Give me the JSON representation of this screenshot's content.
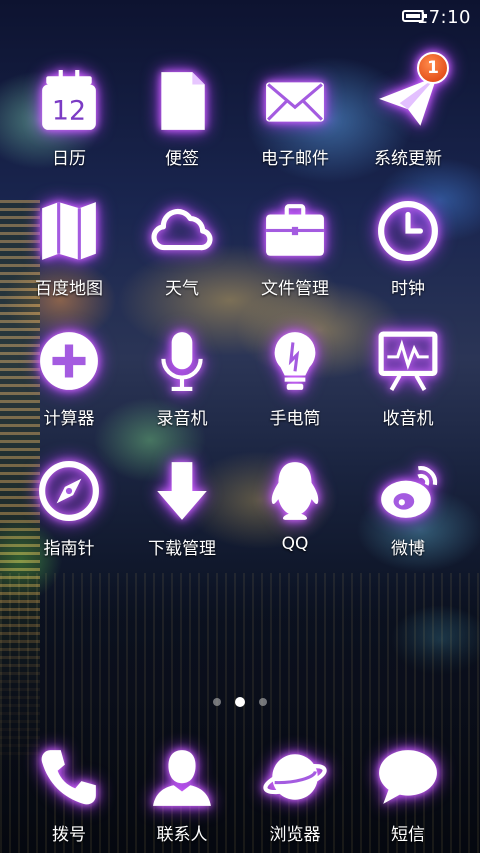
{
  "status_bar": {
    "time": "17:10",
    "battery_icon": "battery-full-icon"
  },
  "apps": [
    {
      "label": "日历",
      "icon": "calendar-icon",
      "day": "12"
    },
    {
      "label": "便签",
      "icon": "note-icon"
    },
    {
      "label": "电子邮件",
      "icon": "mail-icon"
    },
    {
      "label": "系统更新",
      "icon": "paper-plane-icon",
      "badge": "1"
    },
    {
      "label": "百度地图",
      "icon": "map-icon"
    },
    {
      "label": "天气",
      "icon": "cloud-icon"
    },
    {
      "label": "文件管理",
      "icon": "briefcase-icon"
    },
    {
      "label": "时钟",
      "icon": "clock-icon"
    },
    {
      "label": "计算器",
      "icon": "plus-circle-icon"
    },
    {
      "label": "录音机",
      "icon": "microphone-icon"
    },
    {
      "label": "手电筒",
      "icon": "flashlight-icon"
    },
    {
      "label": "收音机",
      "icon": "radio-monitor-icon"
    },
    {
      "label": "指南针",
      "icon": "compass-icon"
    },
    {
      "label": "下载管理",
      "icon": "download-arrow-icon"
    },
    {
      "label": "QQ",
      "icon": "qq-penguin-icon"
    },
    {
      "label": "微博",
      "icon": "weibo-icon"
    }
  ],
  "page_indicator": {
    "pages": 3,
    "current": 2
  },
  "dock": [
    {
      "label": "拨号",
      "icon": "phone-icon"
    },
    {
      "label": "联系人",
      "icon": "contact-person-icon"
    },
    {
      "label": "浏览器",
      "icon": "planet-browser-icon"
    },
    {
      "label": "短信",
      "icon": "speech-bubble-icon"
    }
  ],
  "colors": {
    "icon_fill": "#ffffff",
    "icon_glow": "#c04cff",
    "badge": "#e5531d"
  }
}
